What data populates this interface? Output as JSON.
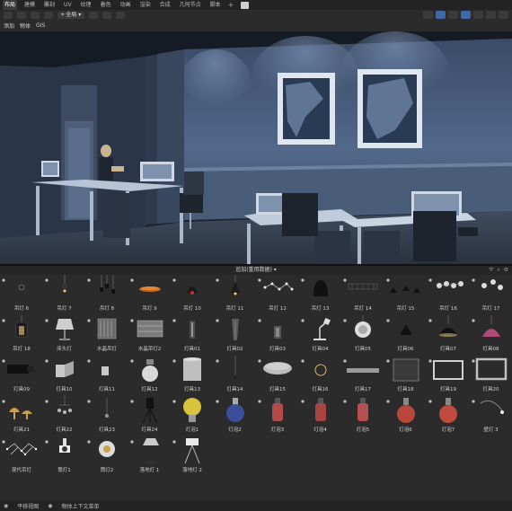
{
  "workspace_tabs": [
    {
      "label": "布局",
      "active": true
    },
    {
      "label": "建模",
      "active": false
    },
    {
      "label": "雕刻",
      "active": false
    },
    {
      "label": "UV",
      "active": false
    },
    {
      "label": "纹理",
      "active": false
    },
    {
      "label": "着色",
      "active": false
    },
    {
      "label": "动画",
      "active": false
    },
    {
      "label": "渲染",
      "active": false
    },
    {
      "label": "合成",
      "active": false
    },
    {
      "label": "几何节点",
      "active": false
    },
    {
      "label": "脚本",
      "active": false
    }
  ],
  "add_tab": "+",
  "viewport_header": {
    "transform_pivot": "全局",
    "menus": [
      "添加",
      "物体",
      "GIS"
    ]
  },
  "asset_browser": {
    "title": "追加(重用数据)",
    "dropdown_arrow": "▾"
  },
  "assets": [
    {
      "label": "吊灯 6",
      "icon": "chandelier-tiny"
    },
    {
      "label": "吊灯 7",
      "icon": "small-pendant"
    },
    {
      "label": "吊灯 8",
      "icon": "triple-pendant"
    },
    {
      "label": "吊灯 9",
      "icon": "disc-pendant"
    },
    {
      "label": "吊灯 10",
      "icon": "black-bell"
    },
    {
      "label": "吊灯 11",
      "icon": "cone-pendant"
    },
    {
      "label": "吊灯 12",
      "icon": "branch-chandelier"
    },
    {
      "label": "吊灯 13",
      "icon": "black-dome"
    },
    {
      "label": "吊灯 14",
      "icon": "linear-pendant"
    },
    {
      "label": "吊灯 15",
      "icon": "spider-pendant"
    },
    {
      "label": "吊灯 16",
      "icon": "bubble-chandelier"
    },
    {
      "label": "吊灯 17",
      "icon": "bubble-chandelier-2"
    },
    {
      "label": "吊灯 18",
      "icon": "hanging-lantern"
    },
    {
      "label": "床头灯",
      "icon": "table-lamp"
    },
    {
      "label": "水晶吊灯",
      "icon": "crystal-chandelier"
    },
    {
      "label": "水晶吊灯2",
      "icon": "crystal-chandelier-2"
    },
    {
      "label": "灯具01",
      "icon": "glass-tube"
    },
    {
      "label": "灯具02",
      "icon": "tall-glass"
    },
    {
      "label": "灯具03",
      "icon": "short-glass"
    },
    {
      "label": "灯具04",
      "icon": "desk-lamp"
    },
    {
      "label": "灯具05",
      "icon": "feather-lamp"
    },
    {
      "label": "灯具06",
      "icon": "black-cone"
    },
    {
      "label": "灯具07",
      "icon": "black-bowl"
    },
    {
      "label": "灯具08",
      "icon": "pink-pendant"
    },
    {
      "label": "灯具09",
      "icon": "black-bar"
    },
    {
      "label": "灯具10",
      "icon": "wall-bracket"
    },
    {
      "label": "灯具11",
      "icon": "small-bracket"
    },
    {
      "label": "灯具12",
      "icon": "globe-lamp"
    },
    {
      "label": "灯具13",
      "icon": "cylinder-shade"
    },
    {
      "label": "灯具14",
      "icon": "thin-pendant"
    },
    {
      "label": "灯具15",
      "icon": "round-ceiling"
    },
    {
      "label": "灯具16",
      "icon": "ring-lamp"
    },
    {
      "label": "灯具17",
      "icon": "linear-light"
    },
    {
      "label": "灯具18",
      "icon": "square-frame"
    },
    {
      "label": "灯具19",
      "icon": "rect-frame"
    },
    {
      "label": "灯具20",
      "icon": "rect-frame-2"
    },
    {
      "label": "灯具21",
      "icon": "mushroom-lamps"
    },
    {
      "label": "灯具22",
      "icon": "hanging-bulbs"
    },
    {
      "label": "灯具23",
      "icon": "small-hanger"
    },
    {
      "label": "灯具24",
      "icon": "tripod-spot"
    },
    {
      "label": "灯泡1",
      "icon": "yellow-bulb"
    },
    {
      "label": "灯泡2",
      "icon": "blue-bulb"
    },
    {
      "label": "灯泡3",
      "icon": "red-tube-bulb"
    },
    {
      "label": "灯泡4",
      "icon": "red-tube-bulb-2"
    },
    {
      "label": "灯泡5",
      "icon": "red-tube-bulb-3"
    },
    {
      "label": "灯泡6",
      "icon": "red-round-bulb"
    },
    {
      "label": "灯泡7",
      "icon": "red-round-bulb-2"
    },
    {
      "label": "壁灯 3",
      "icon": "wall-arc-lamp"
    },
    {
      "label": "现代吊灯",
      "icon": "modern-chandelier"
    },
    {
      "label": "筒灯1",
      "icon": "spotlight"
    },
    {
      "label": "筒灯2",
      "icon": "downlight"
    },
    {
      "label": "落地灯 1",
      "icon": "floor-lamp"
    },
    {
      "label": "落地灯 2",
      "icon": "tripod-floor-lamp"
    }
  ],
  "status_bar": {
    "left": "平移视图",
    "context": "物体上下文菜单"
  }
}
